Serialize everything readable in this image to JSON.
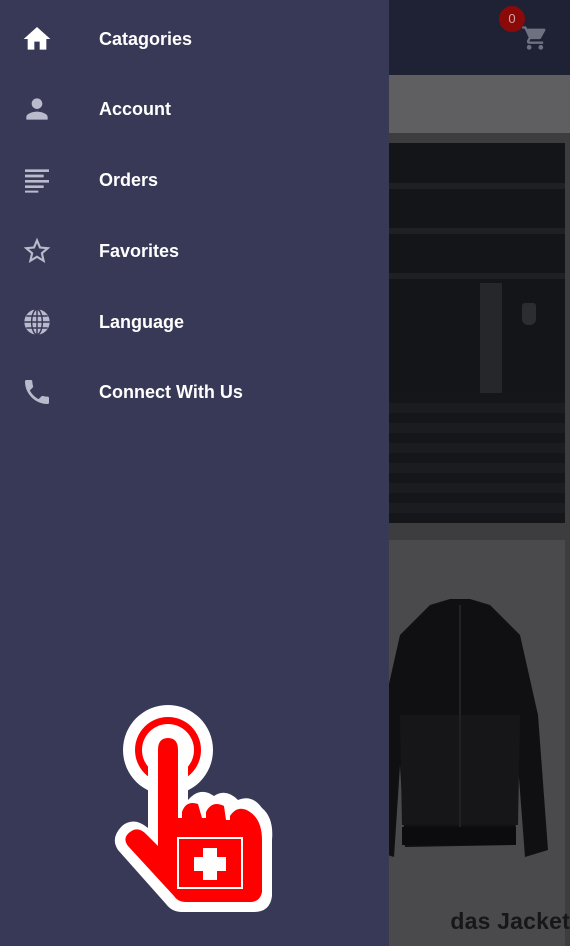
{
  "drawer": {
    "items": [
      {
        "label": "Catagories",
        "icon": "home-icon"
      },
      {
        "label": "Account",
        "icon": "person-icon"
      },
      {
        "label": "Orders",
        "icon": "list-icon"
      },
      {
        "label": "Favorites",
        "icon": "star-outline-icon"
      },
      {
        "label": "Language",
        "icon": "globe-icon"
      },
      {
        "label": "Connect With Us",
        "icon": "phone-icon"
      }
    ],
    "colors": {
      "background": "#373956",
      "icon": "#b9bbcc",
      "active_icon": "#ffffff",
      "text": "#ffffff"
    }
  },
  "app": {
    "cart_count": "0",
    "product_title": "das Jacket",
    "overlay_color": "#000000"
  },
  "logo_icon": "swiss-tap-hand-icon"
}
